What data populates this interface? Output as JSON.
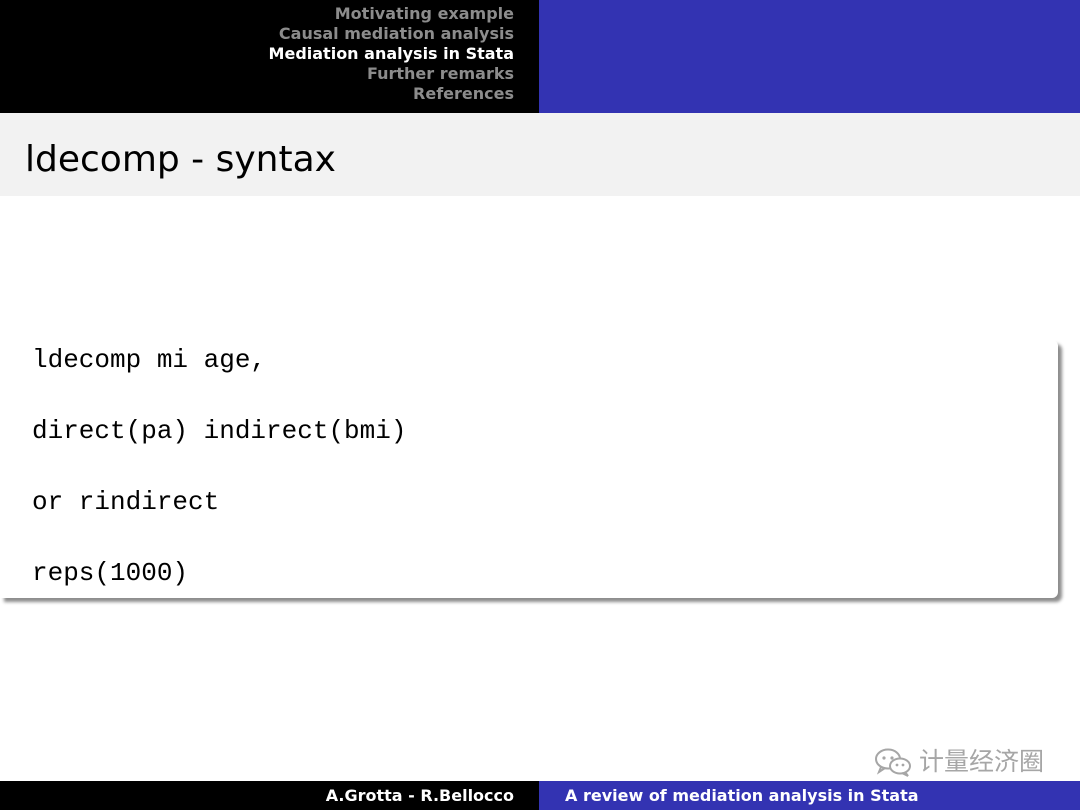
{
  "header": {
    "sections": [
      {
        "label": "Motivating example",
        "active": false
      },
      {
        "label": "Causal mediation analysis",
        "active": false
      },
      {
        "label": "Mediation analysis in Stata",
        "active": true
      },
      {
        "label": "Further remarks",
        "active": false
      },
      {
        "label": "References",
        "active": false
      }
    ]
  },
  "slide": {
    "title": "ldecomp - syntax",
    "code_lines": [
      "ldecomp mi age,",
      "direct(pa) indirect(bmi)",
      "or rindirect",
      "reps(1000)"
    ]
  },
  "watermark": {
    "icon": "wechat-icon",
    "text": "计量经济圈"
  },
  "footer": {
    "authors": "A.Grotta - R.Bellocco",
    "talk_title": "A review of mediation analysis in Stata"
  },
  "colors": {
    "header_left": "#000000",
    "header_right": "#3333b2",
    "nav_inactive": "#8c8c8c",
    "nav_active": "#ffffff",
    "title_bar": "#f2f2f2"
  }
}
